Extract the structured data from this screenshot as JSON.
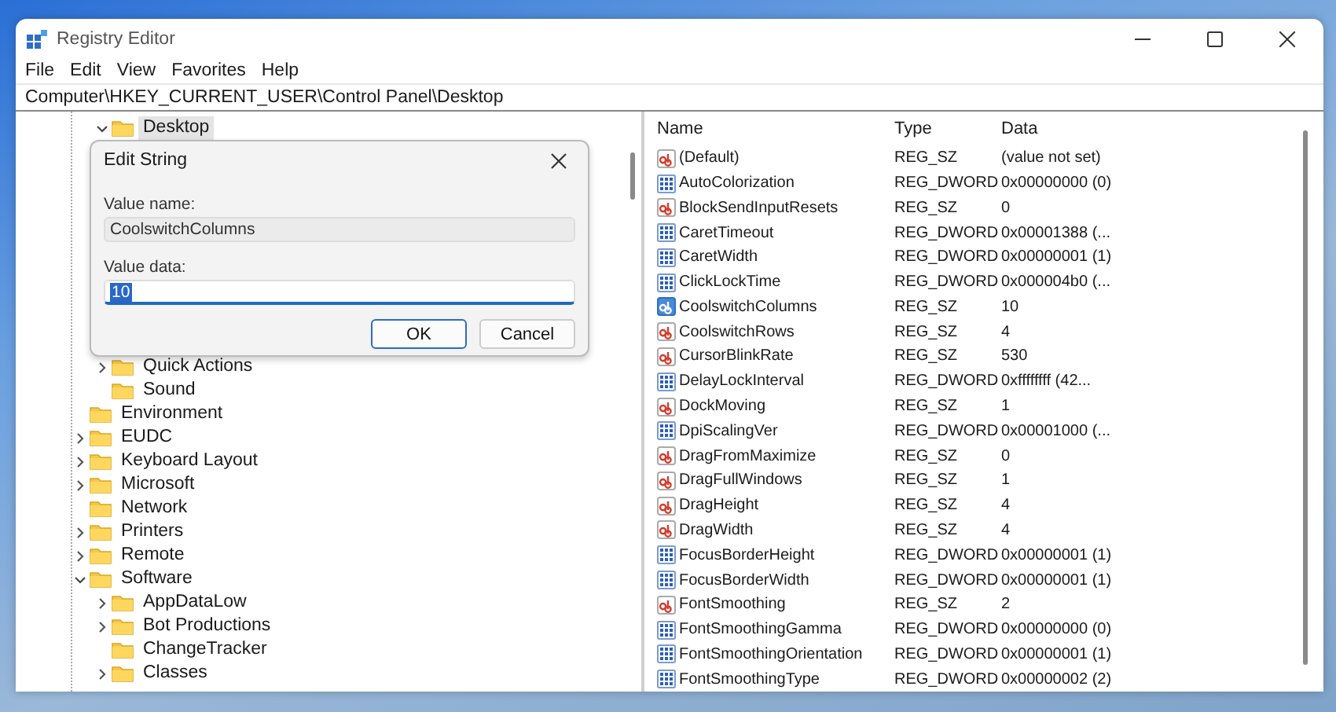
{
  "window": {
    "title": "Registry Editor"
  },
  "menu": [
    "File",
    "Edit",
    "View",
    "Favorites",
    "Help"
  ],
  "address": "Computer\\HKEY_CURRENT_USER\\Control Panel\\Desktop",
  "tree": [
    {
      "children": [
        {
          "label": "Desktop",
          "expandable": true,
          "expanded": true,
          "selected": true
        },
        {
          "label": "Quick Actions",
          "expandable": true,
          "expanded": false,
          "selected": false
        },
        {
          "label": "Sound",
          "expandable": false,
          "selected": false
        }
      ]
    },
    {
      "label": "Environment",
      "expandable": false,
      "selected": false
    },
    {
      "label": "EUDC",
      "expandable": true,
      "expanded": false,
      "selected": false
    },
    {
      "label": "Keyboard Layout",
      "expandable": true,
      "expanded": false,
      "selected": false
    },
    {
      "label": "Microsoft",
      "expandable": true,
      "expanded": false,
      "selected": false
    },
    {
      "label": "Network",
      "expandable": false,
      "selected": false
    },
    {
      "label": "Printers",
      "expandable": true,
      "expanded": false,
      "selected": false
    },
    {
      "label": "Remote",
      "expandable": true,
      "expanded": false,
      "selected": false
    },
    {
      "label": "Software",
      "expandable": true,
      "expanded": true,
      "selected": false,
      "children": [
        {
          "label": "AppDataLow",
          "expandable": true,
          "expanded": false,
          "selected": false
        },
        {
          "label": "Bot Productions",
          "expandable": true,
          "expanded": false,
          "selected": false
        },
        {
          "label": "ChangeTracker",
          "expandable": false,
          "selected": false
        },
        {
          "label": "Classes",
          "expandable": true,
          "expanded": false,
          "selected": false
        }
      ]
    }
  ],
  "table": {
    "columns": [
      "Name",
      "Type",
      "Data"
    ],
    "rows": [
      {
        "kind": "string",
        "name": "(Default)",
        "type": "REG_SZ",
        "data": "(value not set)",
        "selected": false
      },
      {
        "kind": "dword",
        "name": "AutoColorization",
        "type": "REG_DWORD",
        "data": "0x00000000 (0)",
        "selected": false
      },
      {
        "kind": "string",
        "name": "BlockSendInputResets",
        "type": "REG_SZ",
        "data": "0",
        "selected": false
      },
      {
        "kind": "dword",
        "name": "CaretTimeout",
        "type": "REG_DWORD",
        "data": "0x00001388 (...",
        "selected": false
      },
      {
        "kind": "dword",
        "name": "CaretWidth",
        "type": "REG_DWORD",
        "data": "0x00000001 (1)",
        "selected": false
      },
      {
        "kind": "dword",
        "name": "ClickLockTime",
        "type": "REG_DWORD",
        "data": "0x000004b0 (...",
        "selected": false
      },
      {
        "kind": "string",
        "name": "CoolswitchColumns",
        "type": "REG_SZ",
        "data": "10",
        "selected": true
      },
      {
        "kind": "string",
        "name": "CoolswitchRows",
        "type": "REG_SZ",
        "data": "4",
        "selected": false
      },
      {
        "kind": "string",
        "name": "CursorBlinkRate",
        "type": "REG_SZ",
        "data": "530",
        "selected": false
      },
      {
        "kind": "dword",
        "name": "DelayLockInterval",
        "type": "REG_DWORD",
        "data": "0xffffffff (42...",
        "selected": false
      },
      {
        "kind": "string",
        "name": "DockMoving",
        "type": "REG_SZ",
        "data": "1",
        "selected": false
      },
      {
        "kind": "dword",
        "name": "DpiScalingVer",
        "type": "REG_DWORD",
        "data": "0x00001000 (...",
        "selected": false
      },
      {
        "kind": "string",
        "name": "DragFromMaximize",
        "type": "REG_SZ",
        "data": "0",
        "selected": false
      },
      {
        "kind": "string",
        "name": "DragFullWindows",
        "type": "REG_SZ",
        "data": "1",
        "selected": false
      },
      {
        "kind": "string",
        "name": "DragHeight",
        "type": "REG_SZ",
        "data": "4",
        "selected": false
      },
      {
        "kind": "string",
        "name": "DragWidth",
        "type": "REG_SZ",
        "data": "4",
        "selected": false
      },
      {
        "kind": "dword",
        "name": "FocusBorderHeight",
        "type": "REG_DWORD",
        "data": "0x00000001 (1)",
        "selected": false
      },
      {
        "kind": "dword",
        "name": "FocusBorderWidth",
        "type": "REG_DWORD",
        "data": "0x00000001 (1)",
        "selected": false
      },
      {
        "kind": "string",
        "name": "FontSmoothing",
        "type": "REG_SZ",
        "data": "2",
        "selected": false
      },
      {
        "kind": "dword",
        "name": "FontSmoothingGamma",
        "type": "REG_DWORD",
        "data": "0x00000000 (0)",
        "selected": false
      },
      {
        "kind": "dword",
        "name": "FontSmoothingOrientation",
        "type": "REG_DWORD",
        "data": "0x00000001 (1)",
        "selected": false
      },
      {
        "kind": "dword",
        "name": "FontSmoothingType",
        "type": "REG_DWORD",
        "data": "0x00000002 (2)",
        "selected": false
      }
    ]
  },
  "dialog": {
    "title": "Edit String",
    "name_label": "Value name:",
    "name_value": "CoolswitchColumns",
    "data_label": "Value data:",
    "data_value": "10",
    "buttons": [
      {
        "label": "OK",
        "default": true
      },
      {
        "label": "Cancel",
        "default": false
      }
    ]
  }
}
